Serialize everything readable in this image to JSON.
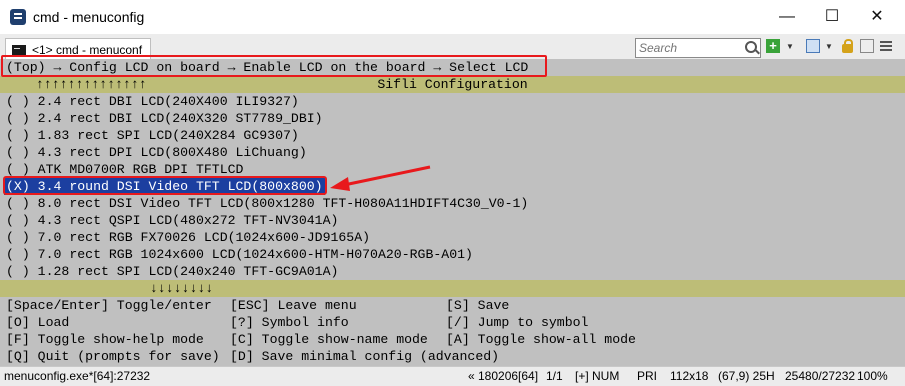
{
  "window": {
    "title": "cmd - menuconfig",
    "minimize": "—",
    "maximize": "☐",
    "close": "✕"
  },
  "tab": {
    "label": "<1> cmd - menuconf"
  },
  "search": {
    "placeholder": "Search"
  },
  "breadcrumb": "(Top) → Config LCD on board → Enable LCD on the board → Select LCD",
  "header": {
    "up_arrows": "↑↑↑↑↑↑↑↑↑↑↑↑↑↑",
    "title": "Sifli Configuration",
    "down_arrows": "↓↓↓↓↓↓↓↓"
  },
  "options": [
    {
      "mark": "( )",
      "label": "2.4 rect DBI LCD(240X400 ILI9327)",
      "selected": false
    },
    {
      "mark": "( )",
      "label": "2.4 rect DBI LCD(240X320 ST7789_DBI)",
      "selected": false
    },
    {
      "mark": "( )",
      "label": "1.83 rect SPI LCD(240X284 GC9307)",
      "selected": false
    },
    {
      "mark": "( )",
      "label": "4.3 rect DPI LCD(800X480 LiChuang)",
      "selected": false
    },
    {
      "mark": "( )",
      "label": "ATK MD0700R RGB DPI TFTLCD",
      "selected": false
    },
    {
      "mark": "(X)",
      "label": "3.4 round DSI Video TFT LCD(800x800)",
      "selected": true
    },
    {
      "mark": "( )",
      "label": "8.0 rect DSI Video TFT LCD(800x1280 TFT-H080A11HDIFT4C30_V0-1)",
      "selected": false
    },
    {
      "mark": "( )",
      "label": "4.3 rect QSPI LCD(480x272 TFT-NV3041A)",
      "selected": false
    },
    {
      "mark": "( )",
      "label": "7.0 rect RGB FX70026 LCD(1024x600-JD9165A)",
      "selected": false
    },
    {
      "mark": "( )",
      "label": "7.0 rect RGB 1024x600 LCD(1024x600-HTM-H070A20-RGB-A01)",
      "selected": false
    },
    {
      "mark": "( )",
      "label": "1.28 rect SPI LCD(240x240 TFT-GC9A01A)",
      "selected": false
    }
  ],
  "help": [
    [
      "[Space/Enter] Toggle/enter",
      "[ESC] Leave menu",
      "[S] Save"
    ],
    [
      "[O] Load",
      "[?] Symbol info",
      "[/] Jump to symbol"
    ],
    [
      "[F] Toggle show-help mode",
      "[C] Toggle show-name mode",
      "[A] Toggle show-all mode"
    ],
    [
      "[Q] Quit (prompts for save)",
      "[D] Save minimal config (advanced)",
      ""
    ]
  ],
  "status": {
    "process": "menuconfig.exe*[64]:27232",
    "build": "« 180206[64]",
    "page": "1/1",
    "num": "[+] NUM",
    "pri": "PRI",
    "size": "112x18",
    "cursor": "(67,9) 25H",
    "memory": "25480/27232",
    "zoom": "100%"
  },
  "colors": {
    "annotation": "#e8191c",
    "selection": "#1c3fa0",
    "bar": "#bdbd77"
  }
}
